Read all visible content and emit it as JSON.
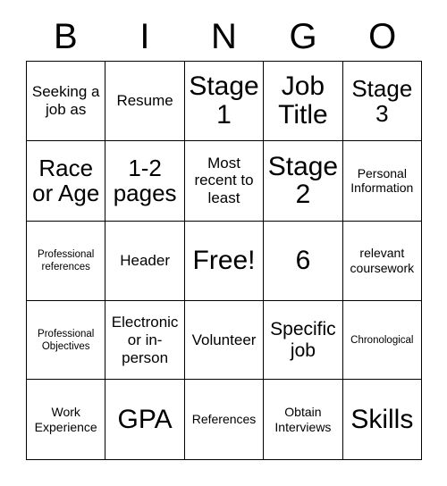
{
  "card": {
    "header_letters": [
      "B",
      "I",
      "N",
      "G",
      "O"
    ],
    "rows": [
      [
        {
          "text": "Seeking a job as",
          "size": "m"
        },
        {
          "text": "Resume",
          "size": "m"
        },
        {
          "text": "Stage 1",
          "size": "xxl"
        },
        {
          "text": "Job Title",
          "size": "xxl"
        },
        {
          "text": "Stage 3",
          "size": "xl"
        }
      ],
      [
        {
          "text": "Race or Age",
          "size": "xl"
        },
        {
          "text": "1-2 pages",
          "size": "xl"
        },
        {
          "text": "Most recent to least",
          "size": "m"
        },
        {
          "text": "Stage 2",
          "size": "xxl"
        },
        {
          "text": "Personal Information",
          "size": "s"
        }
      ],
      [
        {
          "text": "Professional references",
          "size": "xs"
        },
        {
          "text": "Header",
          "size": "m"
        },
        {
          "text": "Free!",
          "size": "xxl"
        },
        {
          "text": "6",
          "size": "xxl"
        },
        {
          "text": "relevant coursework",
          "size": "s"
        }
      ],
      [
        {
          "text": "Professional Objectives",
          "size": "xs"
        },
        {
          "text": "Electronic or in-person",
          "size": "m"
        },
        {
          "text": "Volunteer",
          "size": "m"
        },
        {
          "text": "Specific job",
          "size": "l"
        },
        {
          "text": "Chronological",
          "size": "xs"
        }
      ],
      [
        {
          "text": "Work Experience",
          "size": "s"
        },
        {
          "text": "GPA",
          "size": "xxl"
        },
        {
          "text": "References",
          "size": "s"
        },
        {
          "text": "Obtain Interviews",
          "size": "s"
        },
        {
          "text": "Skills",
          "size": "xxl"
        }
      ]
    ]
  },
  "colors": {
    "background": "#ffffff",
    "text": "#000000",
    "border": "#000000"
  }
}
